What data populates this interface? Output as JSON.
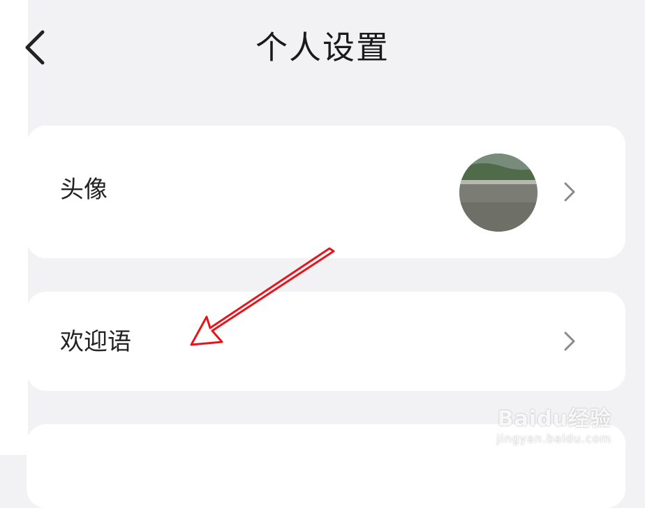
{
  "header": {
    "title": "个人设置",
    "back_icon": "chevron-left-icon"
  },
  "rows": [
    {
      "label": "头像",
      "icon": "chevron-right-icon"
    },
    {
      "label": "欢迎语",
      "icon": "chevron-right-icon"
    }
  ],
  "annotation": {
    "color": "#e8141c"
  },
  "watermark": {
    "logo": "Baidu经验",
    "url": "jingyan.baidu.com"
  }
}
